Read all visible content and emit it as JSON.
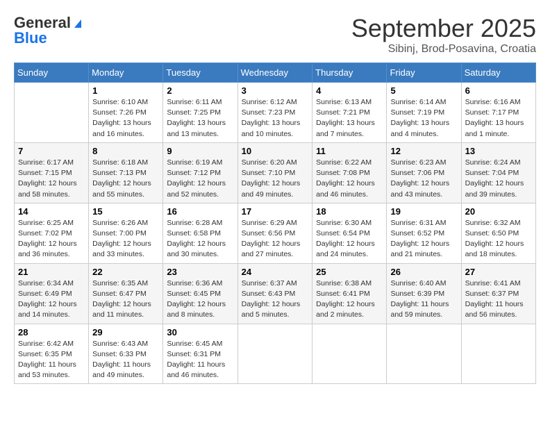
{
  "logo": {
    "general": "General",
    "blue": "Blue"
  },
  "title": "September 2025",
  "subtitle": "Sibinj, Brod-Posavina, Croatia",
  "weekdays": [
    "Sunday",
    "Monday",
    "Tuesday",
    "Wednesday",
    "Thursday",
    "Friday",
    "Saturday"
  ],
  "weeks": [
    [
      {
        "day": "",
        "sunrise": "",
        "sunset": "",
        "daylight": ""
      },
      {
        "day": "1",
        "sunrise": "Sunrise: 6:10 AM",
        "sunset": "Sunset: 7:26 PM",
        "daylight": "Daylight: 13 hours and 16 minutes."
      },
      {
        "day": "2",
        "sunrise": "Sunrise: 6:11 AM",
        "sunset": "Sunset: 7:25 PM",
        "daylight": "Daylight: 13 hours and 13 minutes."
      },
      {
        "day": "3",
        "sunrise": "Sunrise: 6:12 AM",
        "sunset": "Sunset: 7:23 PM",
        "daylight": "Daylight: 13 hours and 10 minutes."
      },
      {
        "day": "4",
        "sunrise": "Sunrise: 6:13 AM",
        "sunset": "Sunset: 7:21 PM",
        "daylight": "Daylight: 13 hours and 7 minutes."
      },
      {
        "day": "5",
        "sunrise": "Sunrise: 6:14 AM",
        "sunset": "Sunset: 7:19 PM",
        "daylight": "Daylight: 13 hours and 4 minutes."
      },
      {
        "day": "6",
        "sunrise": "Sunrise: 6:16 AM",
        "sunset": "Sunset: 7:17 PM",
        "daylight": "Daylight: 13 hours and 1 minute."
      }
    ],
    [
      {
        "day": "7",
        "sunrise": "Sunrise: 6:17 AM",
        "sunset": "Sunset: 7:15 PM",
        "daylight": "Daylight: 12 hours and 58 minutes."
      },
      {
        "day": "8",
        "sunrise": "Sunrise: 6:18 AM",
        "sunset": "Sunset: 7:13 PM",
        "daylight": "Daylight: 12 hours and 55 minutes."
      },
      {
        "day": "9",
        "sunrise": "Sunrise: 6:19 AM",
        "sunset": "Sunset: 7:12 PM",
        "daylight": "Daylight: 12 hours and 52 minutes."
      },
      {
        "day": "10",
        "sunrise": "Sunrise: 6:20 AM",
        "sunset": "Sunset: 7:10 PM",
        "daylight": "Daylight: 12 hours and 49 minutes."
      },
      {
        "day": "11",
        "sunrise": "Sunrise: 6:22 AM",
        "sunset": "Sunset: 7:08 PM",
        "daylight": "Daylight: 12 hours and 46 minutes."
      },
      {
        "day": "12",
        "sunrise": "Sunrise: 6:23 AM",
        "sunset": "Sunset: 7:06 PM",
        "daylight": "Daylight: 12 hours and 43 minutes."
      },
      {
        "day": "13",
        "sunrise": "Sunrise: 6:24 AM",
        "sunset": "Sunset: 7:04 PM",
        "daylight": "Daylight: 12 hours and 39 minutes."
      }
    ],
    [
      {
        "day": "14",
        "sunrise": "Sunrise: 6:25 AM",
        "sunset": "Sunset: 7:02 PM",
        "daylight": "Daylight: 12 hours and 36 minutes."
      },
      {
        "day": "15",
        "sunrise": "Sunrise: 6:26 AM",
        "sunset": "Sunset: 7:00 PM",
        "daylight": "Daylight: 12 hours and 33 minutes."
      },
      {
        "day": "16",
        "sunrise": "Sunrise: 6:28 AM",
        "sunset": "Sunset: 6:58 PM",
        "daylight": "Daylight: 12 hours and 30 minutes."
      },
      {
        "day": "17",
        "sunrise": "Sunrise: 6:29 AM",
        "sunset": "Sunset: 6:56 PM",
        "daylight": "Daylight: 12 hours and 27 minutes."
      },
      {
        "day": "18",
        "sunrise": "Sunrise: 6:30 AM",
        "sunset": "Sunset: 6:54 PM",
        "daylight": "Daylight: 12 hours and 24 minutes."
      },
      {
        "day": "19",
        "sunrise": "Sunrise: 6:31 AM",
        "sunset": "Sunset: 6:52 PM",
        "daylight": "Daylight: 12 hours and 21 minutes."
      },
      {
        "day": "20",
        "sunrise": "Sunrise: 6:32 AM",
        "sunset": "Sunset: 6:50 PM",
        "daylight": "Daylight: 12 hours and 18 minutes."
      }
    ],
    [
      {
        "day": "21",
        "sunrise": "Sunrise: 6:34 AM",
        "sunset": "Sunset: 6:49 PM",
        "daylight": "Daylight: 12 hours and 14 minutes."
      },
      {
        "day": "22",
        "sunrise": "Sunrise: 6:35 AM",
        "sunset": "Sunset: 6:47 PM",
        "daylight": "Daylight: 12 hours and 11 minutes."
      },
      {
        "day": "23",
        "sunrise": "Sunrise: 6:36 AM",
        "sunset": "Sunset: 6:45 PM",
        "daylight": "Daylight: 12 hours and 8 minutes."
      },
      {
        "day": "24",
        "sunrise": "Sunrise: 6:37 AM",
        "sunset": "Sunset: 6:43 PM",
        "daylight": "Daylight: 12 hours and 5 minutes."
      },
      {
        "day": "25",
        "sunrise": "Sunrise: 6:38 AM",
        "sunset": "Sunset: 6:41 PM",
        "daylight": "Daylight: 12 hours and 2 minutes."
      },
      {
        "day": "26",
        "sunrise": "Sunrise: 6:40 AM",
        "sunset": "Sunset: 6:39 PM",
        "daylight": "Daylight: 11 hours and 59 minutes."
      },
      {
        "day": "27",
        "sunrise": "Sunrise: 6:41 AM",
        "sunset": "Sunset: 6:37 PM",
        "daylight": "Daylight: 11 hours and 56 minutes."
      }
    ],
    [
      {
        "day": "28",
        "sunrise": "Sunrise: 6:42 AM",
        "sunset": "Sunset: 6:35 PM",
        "daylight": "Daylight: 11 hours and 53 minutes."
      },
      {
        "day": "29",
        "sunrise": "Sunrise: 6:43 AM",
        "sunset": "Sunset: 6:33 PM",
        "daylight": "Daylight: 11 hours and 49 minutes."
      },
      {
        "day": "30",
        "sunrise": "Sunrise: 6:45 AM",
        "sunset": "Sunset: 6:31 PM",
        "daylight": "Daylight: 11 hours and 46 minutes."
      },
      {
        "day": "",
        "sunrise": "",
        "sunset": "",
        "daylight": ""
      },
      {
        "day": "",
        "sunrise": "",
        "sunset": "",
        "daylight": ""
      },
      {
        "day": "",
        "sunrise": "",
        "sunset": "",
        "daylight": ""
      },
      {
        "day": "",
        "sunrise": "",
        "sunset": "",
        "daylight": ""
      }
    ]
  ]
}
